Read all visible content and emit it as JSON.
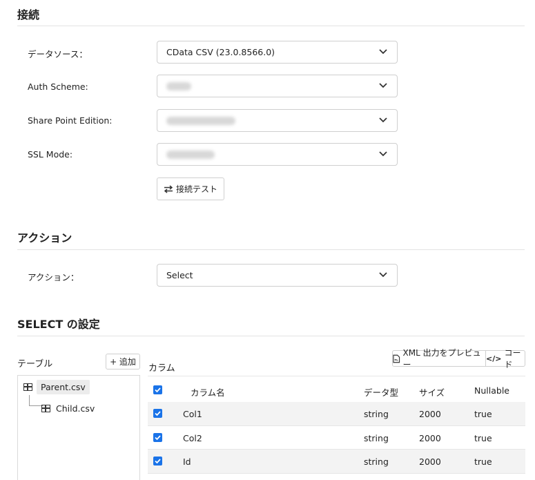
{
  "connection": {
    "title": "接続",
    "datasource_label": "データソース：",
    "datasource_value": "CData CSV (23.0.8566.0)",
    "auth_label": "Auth Scheme:",
    "sharepoint_label": "Share Point Edition:",
    "ssl_label": "SSL Mode:",
    "test_button": "接続テスト"
  },
  "action": {
    "title": "アクション",
    "label": "アクション：",
    "value": "Select"
  },
  "select_settings": {
    "title": "SELECT の設定",
    "table_label": "テーブル",
    "add_button": "+ 追加",
    "column_label": "カラム",
    "preview_button": "XML 出力をプレビュー",
    "code_button": "コード",
    "tree": [
      {
        "label": "Parent.csv"
      },
      {
        "label": "Child.csv"
      }
    ],
    "columns": {
      "name": "カラム名",
      "type": "データ型",
      "size": "サイズ",
      "nullable": "Nullable"
    },
    "rows": [
      {
        "name": "Col1",
        "type": "string",
        "size": "2000",
        "nullable": "true"
      },
      {
        "name": "Col2",
        "type": "string",
        "size": "2000",
        "nullable": "true"
      },
      {
        "name": "Id",
        "type": "string",
        "size": "2000",
        "nullable": "true"
      }
    ]
  },
  "colors": {
    "accent": "#1a73e8",
    "border": "#cfcfcf",
    "row_alt": "#f3f3f3"
  }
}
